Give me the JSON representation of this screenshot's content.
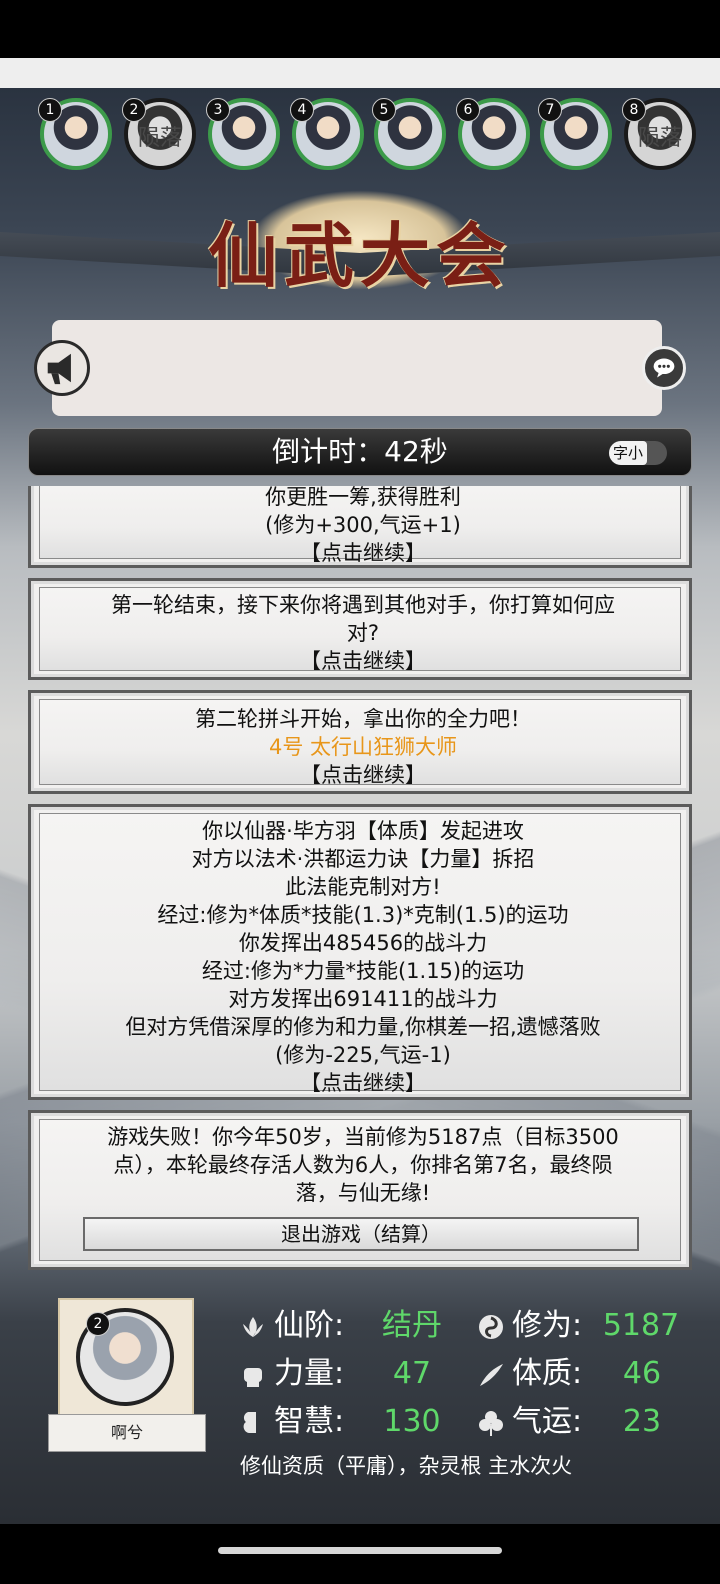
{
  "players": [
    {
      "num": "1",
      "status": ""
    },
    {
      "num": "2",
      "status": "陨落"
    },
    {
      "num": "3",
      "status": ""
    },
    {
      "num": "4",
      "status": ""
    },
    {
      "num": "5",
      "status": ""
    },
    {
      "num": "6",
      "status": ""
    },
    {
      "num": "7",
      "status": ""
    },
    {
      "num": "8",
      "status": "陨落"
    }
  ],
  "banner": {
    "title": "仙武大会"
  },
  "countdown": {
    "text": "倒计时：42秒",
    "toggle_label": "字小"
  },
  "log": {
    "card1": {
      "lines": [
        "你更胜一筹,获得胜利",
        "(修为+300,气运+1)",
        "【点击继续】"
      ]
    },
    "card2": {
      "lines": [
        "第一轮结束，接下来你将遇到其他对手，你打算如何应",
        "对?",
        "【点击继续】"
      ]
    },
    "card3": {
      "lines": [
        "第二轮拼斗开始，拿出你的全力吧！",
        "4号 太行山狂狮大师",
        "【点击继续】"
      ]
    },
    "card4": {
      "lines": [
        "你以仙器·毕方羽【体质】发起进攻",
        "对方以法术·洪都运力诀【力量】拆招",
        "此法能克制对方!",
        "经过:修为*体质*技能(1.3)*克制(1.5)的运功",
        "你发挥出485456的战斗力",
        "经过:修为*力量*技能(1.15)的运功",
        "对方发挥出691411的战斗力",
        "但对方凭借深厚的修为和力量,你棋差一招,遗憾落败",
        "(修为-225,气运-1)",
        "【点击继续】"
      ]
    },
    "card5": {
      "lines": [
        "游戏失败！你今年50岁，当前修为5187点（目标3500",
        "点），本轮最终存活人数为6人，你排名第7名，最终陨",
        "落，与仙无缘!"
      ],
      "exit_label": "退出游戏（结算）"
    }
  },
  "profile": {
    "num": "2",
    "name": "啊兮",
    "stats": {
      "realm_label": "仙阶:",
      "realm_value": "结丹",
      "cultivation_label": "修为:",
      "cultivation_value": "5187",
      "strength_label": "力量:",
      "strength_value": "47",
      "constitution_label": "体质:",
      "constitution_value": "46",
      "wisdom_label": "智慧:",
      "wisdom_value": "130",
      "luck_label": "气运:",
      "luck_value": "23"
    },
    "aptitude": "修仙资质（平庸），杂灵根 主水次火"
  },
  "colors": {
    "stat_value": "#5fd86a",
    "fallen_text": "#e02020",
    "highlight": "#e8961a",
    "alive_ring": "#3c9a4a"
  }
}
